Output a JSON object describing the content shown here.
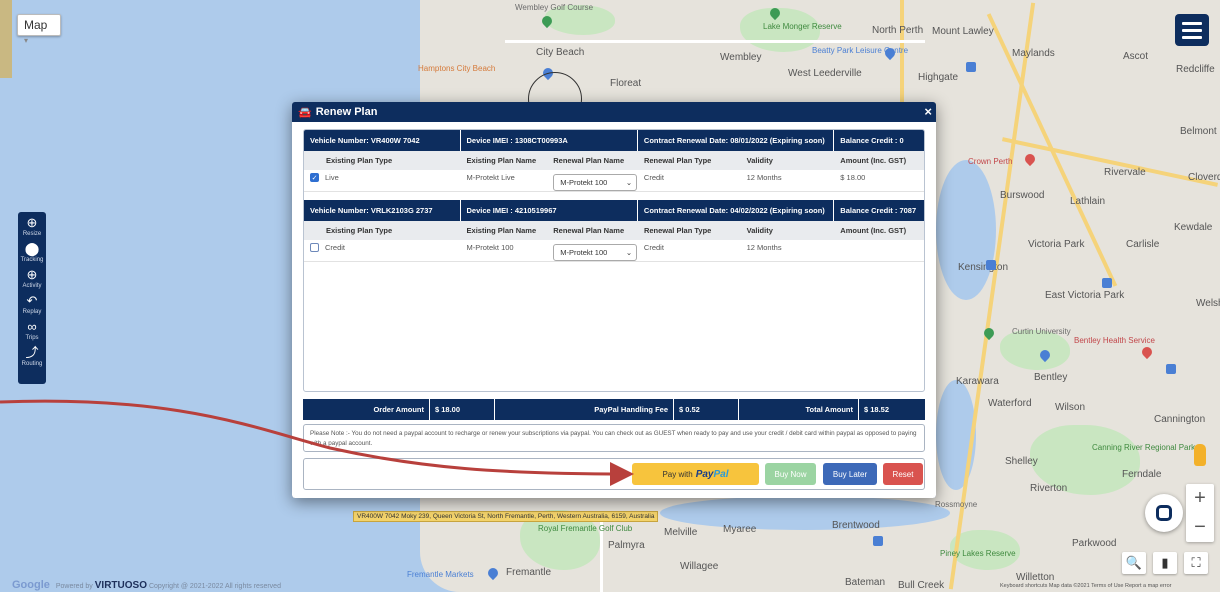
{
  "map": {
    "type_button": "Map",
    "toolbar": [
      {
        "label": "Resize",
        "icon": "resize-icon",
        "glyph": "⊕"
      },
      {
        "label": "Tracking",
        "icon": "location-pin-icon",
        "glyph": "⬤"
      },
      {
        "label": "Activity",
        "icon": "crosshair-icon",
        "glyph": "⊕"
      },
      {
        "label": "Replay",
        "icon": "replay-icon",
        "glyph": "↶"
      },
      {
        "label": "Trips",
        "icon": "trips-icon",
        "glyph": "∞"
      },
      {
        "label": "Routing",
        "icon": "routing-icon",
        "glyph": "⤴"
      }
    ],
    "labels": {
      "wembley_golf": "Wembley Golf Course",
      "lake_monger": "Lake Monger Reserve",
      "north_perth": "North Perth",
      "mount_lawley": "Mount Lawley",
      "maylands": "Maylands",
      "ascot": "Ascot",
      "redcliffe": "Redcliffe",
      "city_beach": "City Beach",
      "wembley": "Wembley",
      "beatty_park": "Beatty Park Leisure Centre",
      "highgate": "Highgate",
      "hamptons": "Hamptons City Beach",
      "floreat": "Floreat",
      "west_leederville": "West Leederville",
      "belmont": "Belmont",
      "crown_perth": "Crown Perth",
      "rivervale": "Rivervale",
      "cloverdale": "Cloverdale",
      "burswood": "Burswood",
      "lathlain": "Lathlain",
      "kewdale": "Kewdale",
      "victoria_park": "Victoria Park",
      "carlisle": "Carlisle",
      "kensington": "Kensington",
      "east_victoria_park": "East Victoria Park",
      "welshpool": "Welsh",
      "curtin": "Curtin University",
      "bentley_health": "Bentley Health Service",
      "karawara": "Karawara",
      "bentley": "Bentley",
      "waterford": "Waterford",
      "wilson": "Wilson",
      "cannington": "Cannington",
      "canning_river": "Canning River Regional Park",
      "shelley": "Shelley",
      "ferndale": "Ferndale",
      "riverton": "Riverton",
      "rossmoyne": "Rossmoyne",
      "brentwood": "Brentwood",
      "royal_fremantle": "Royal Fremantle Golf Club",
      "melville": "Melville",
      "myaree": "Myaree",
      "palmyra": "Palmyra",
      "parkwood": "Parkwood",
      "piney_lakes": "Piney Lakes Reserve",
      "willagee": "Willagee",
      "fremantle_markets": "Fremantle Markets",
      "fremantle": "Fremantle",
      "willetton": "Willetton",
      "bateman": "Bateman",
      "bull_creek": "Bull Creek"
    },
    "address": "VR400W 7042 Moky 239, Queen Victoria St, North Fremantle, Perth, Western Australia, 6159, Australia",
    "footer_google": "Google",
    "footer_powered": "Powered by",
    "footer_brand": "VIRTUOSO",
    "footer_copyright": "Copyright @ 2021-2022 All rights reserved",
    "footer_right": "Keyboard shortcuts   Map data ©2021   Terms of Use   Report a map error"
  },
  "modal": {
    "title": "Renew Plan",
    "close": "×",
    "columns": [
      "Existing Plan Type",
      "Existing Plan Name",
      "Renewal Plan Name",
      "Renewal Plan Type",
      "Validity",
      "Amount (Inc. GST)"
    ],
    "vehicles": [
      {
        "vehicle": "Vehicle Number: VR400W 7042",
        "imei": "Device IMEI : 1308CT00993A",
        "renewal": "Contract Renewal Date: 08/01/2022 (Expiring soon)",
        "balance": "Balance Credit : 0",
        "checked": true,
        "existing_type": "Live",
        "existing_name": "M-Protekt Live",
        "renewal_name": "M-Protekt 100",
        "renewal_type": "Credit",
        "validity": "12 Months",
        "amount": "$ 18.00"
      },
      {
        "vehicle": "Vehicle Number: VRLK2103G 2737",
        "imei": "Device IMEI : 4210519967",
        "renewal": "Contract Renewal Date: 04/02/2022 (Expiring soon)",
        "balance": "Balance Credit : 7087",
        "checked": false,
        "existing_type": "Credit",
        "existing_name": "M-Protekt 100",
        "renewal_name": "M-Protekt 100",
        "renewal_type": "Credit",
        "validity": "12 Months",
        "amount": ""
      }
    ],
    "summary": {
      "order_label": "Order Amount",
      "order_value": "$ 18.00",
      "fee_label": "PayPal Handling Fee",
      "fee_value": "$ 0.52",
      "total_label": "Total Amount",
      "total_value": "$ 18.52"
    },
    "note": "Please Note :- You do not need a paypal account to recharge or renew your subscriptions via paypal. You can check out as GUEST when ready to pay and use your credit / debit card within paypal as opposed to paying with a paypal account.",
    "buttons": {
      "paypal_prefix": "Pay with",
      "paypal_word1": "Pay",
      "paypal_word2": "Pal",
      "buy_now": "Buy Now",
      "buy_later": "Buy Later",
      "reset": "Reset"
    }
  },
  "colors": {
    "navy": "#0d2d5e",
    "paypal_yellow": "#f7c43d",
    "buy_now_green": "#9bd4a2",
    "buy_later_blue": "#3d69b8",
    "reset_red": "#d9534f",
    "arrow": "#b8403c"
  }
}
